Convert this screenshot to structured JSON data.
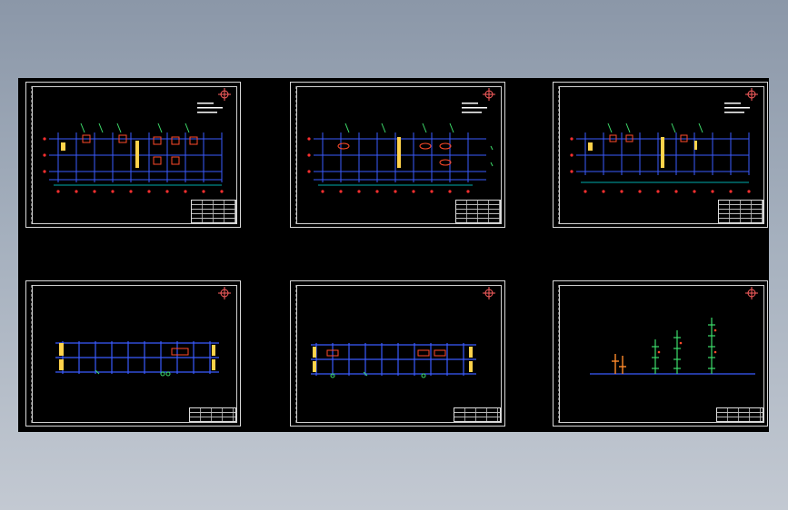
{
  "viewer": {
    "background_top": "#8b97a8",
    "background_bottom": "#c3c9d2",
    "canvas_color": "#000000"
  },
  "sheets": [
    {
      "id": "sheet-1",
      "kind": "floor-plan"
    },
    {
      "id": "sheet-2",
      "kind": "floor-plan"
    },
    {
      "id": "sheet-3",
      "kind": "floor-plan"
    },
    {
      "id": "sheet-4",
      "kind": "section"
    },
    {
      "id": "sheet-5",
      "kind": "section"
    },
    {
      "id": "sheet-6",
      "kind": "riser-diagram"
    }
  ],
  "colors": {
    "grid_line": "#3a5bff",
    "axis_marker": "#ff3030",
    "dimension": "#00e5e5",
    "fixture": "#ffd24a",
    "pipe_red": "#ff4a2a",
    "pipe_green": "#3ddc6a",
    "frame": "#d8d8d8"
  },
  "icons": {
    "north_arrow": "north-arrow-icon"
  }
}
